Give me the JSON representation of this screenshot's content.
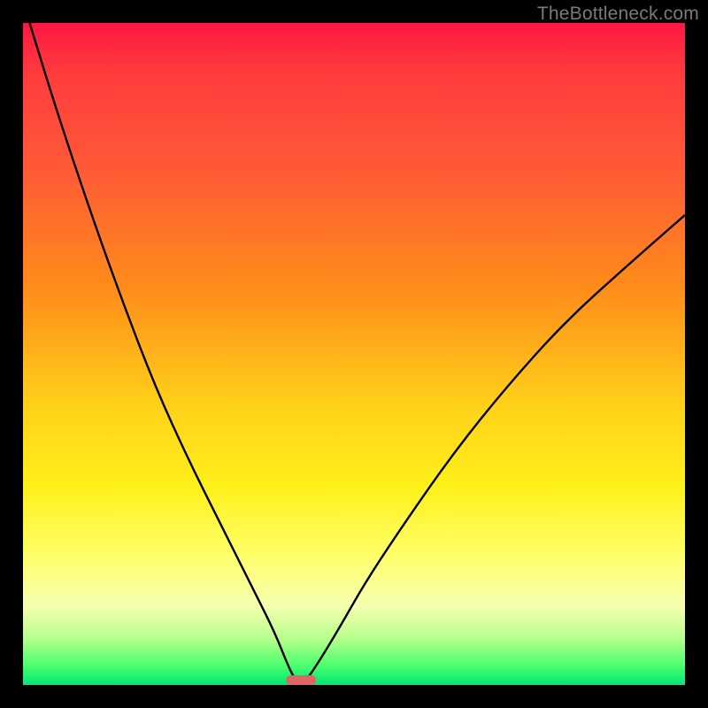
{
  "watermark": "TheBottleneck.com",
  "chart_data": {
    "type": "line",
    "title": "",
    "xlabel": "",
    "ylabel": "",
    "xlim": [
      0,
      100
    ],
    "ylim": [
      0,
      100
    ],
    "series": [
      {
        "name": "bottleneck-curve",
        "x": [
          1,
          5,
          10,
          15,
          20,
          25,
          30,
          35,
          38,
          40,
          41,
          42,
          43,
          45,
          48,
          52,
          58,
          65,
          73,
          82,
          92,
          100
        ],
        "y": [
          100,
          87,
          72,
          58,
          45,
          34,
          24,
          14,
          8,
          3,
          1,
          0,
          1,
          4,
          9,
          16,
          25,
          35,
          45,
          55,
          64,
          71
        ]
      }
    ],
    "marker": {
      "name": "optimal-marker",
      "x_center": 42,
      "width_pct": 4.5,
      "color": "#e06666"
    },
    "gradient_stops": [
      {
        "pct": 0,
        "color": "#ff1744"
      },
      {
        "pct": 40,
        "color": "#ff8c1a"
      },
      {
        "pct": 70,
        "color": "#fff01a"
      },
      {
        "pct": 100,
        "color": "#00e676"
      }
    ]
  }
}
